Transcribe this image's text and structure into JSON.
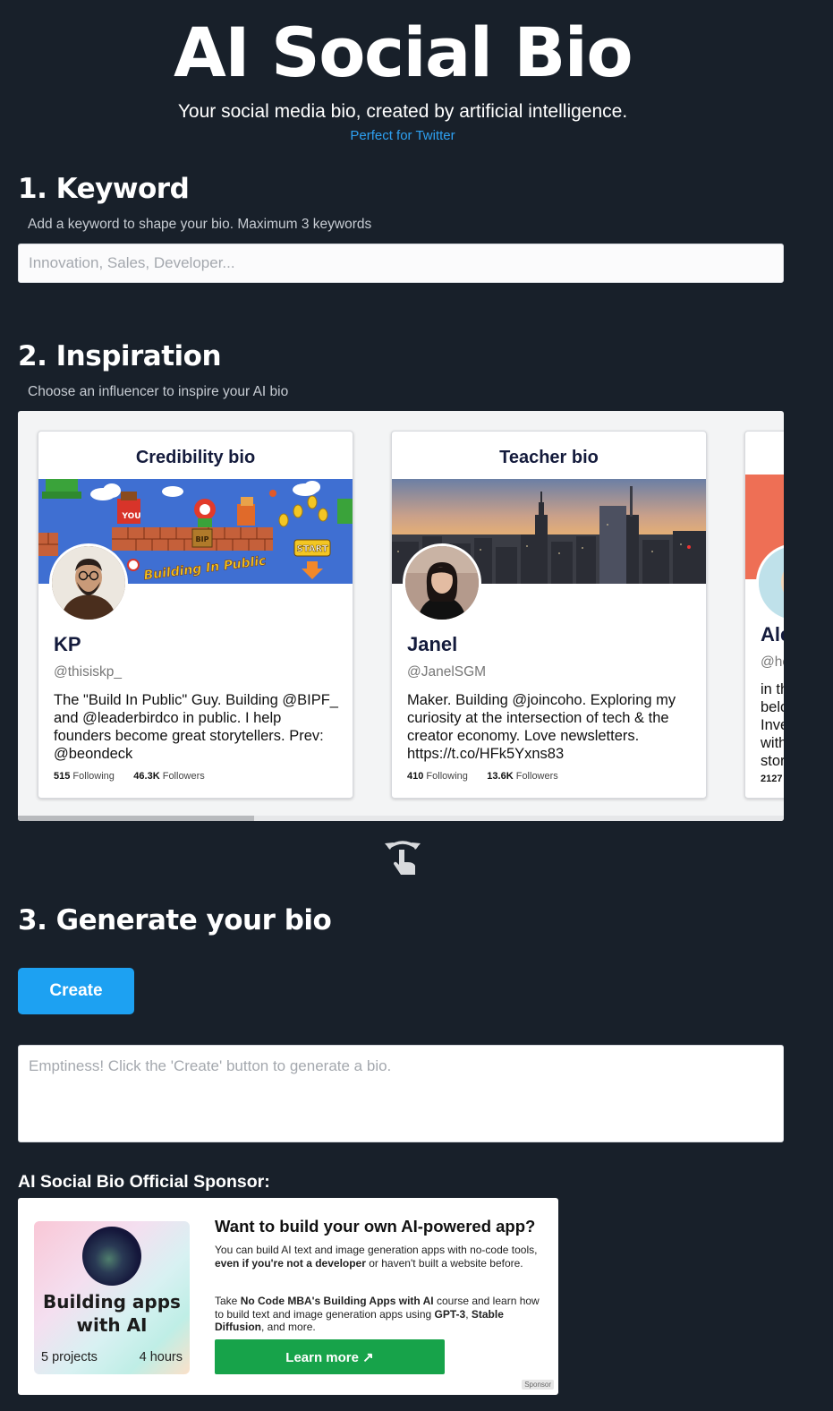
{
  "header": {
    "title": "AI Social Bio",
    "subtitle": "Your social media bio, created by artificial intelligence.",
    "tagline": "Perfect for Twitter"
  },
  "keyword": {
    "heading": "1. Keyword",
    "hint": "Add a keyword to shape your bio. Maximum 3 keywords",
    "placeholder": "Innovation, Sales, Developer..."
  },
  "inspiration": {
    "heading": "2. Inspiration",
    "hint": "Choose an influencer to inspire your AI bio",
    "cards": [
      {
        "type": "Credibility bio",
        "name": "KP",
        "handle": "@thisiskp_",
        "bio": "The \"Build In Public\" Guy. Building @BIPF_ and @leaderbirdco in public. I help founders become great storytellers. Prev: @beondeck",
        "following": "515",
        "following_label": "Following",
        "followers": "46.3K",
        "followers_label": "Followers",
        "banner_text_you": "YOU",
        "banner_text_bip": "BIP",
        "banner_text_start": "START",
        "banner_text_building": "Building In Public"
      },
      {
        "type": "Teacher bio",
        "name": "Janel",
        "handle": "@JanelSGM",
        "bio": "Maker. Building @joincoho. Exploring my curiosity at the intersection of tech & the creator economy. Love newsletters. https://t.co/HFk5Yxns83",
        "following": "410",
        "following_label": "Following",
        "followers": "13.6K",
        "followers_label": "Followers"
      },
      {
        "name_partial": "Ale",
        "handle_partial": "@he",
        "bio_partial": [
          "in th",
          "belo",
          "Inve",
          "with",
          "stor"
        ],
        "following_partial": "2127"
      }
    ]
  },
  "generate": {
    "heading": "3. Generate your bio",
    "create_label": "Create",
    "output_placeholder": "Emptiness! Click the 'Create' button to generate a bio."
  },
  "sponsor": {
    "label": "AI Social Bio Official Sponsor:",
    "image_title": "Building apps with AI",
    "image_projects": "5 projects",
    "image_hours": "4 hours",
    "heading": "Want to build your own AI-powered app?",
    "p1_a": "You can build AI text and image generation apps with no-code tools, ",
    "p1_b": "even if you're not a developer",
    "p1_c": " or haven't built a website before.",
    "p2_a": "Take ",
    "p2_b": "No Code MBA's Building Apps with AI",
    "p2_c": " course and learn how to build text and image generation apps using ",
    "p2_d": "GPT-3",
    "p2_e": ", ",
    "p2_f": "Stable Diffusion",
    "p2_g": ", and more.",
    "button_label": "Learn more ↗",
    "badge": "Sponsor"
  },
  "colors": {
    "background": "#18202a",
    "accent": "#1da1f2",
    "link": "#2ea1f2",
    "sponsor_button": "#17a34a"
  }
}
